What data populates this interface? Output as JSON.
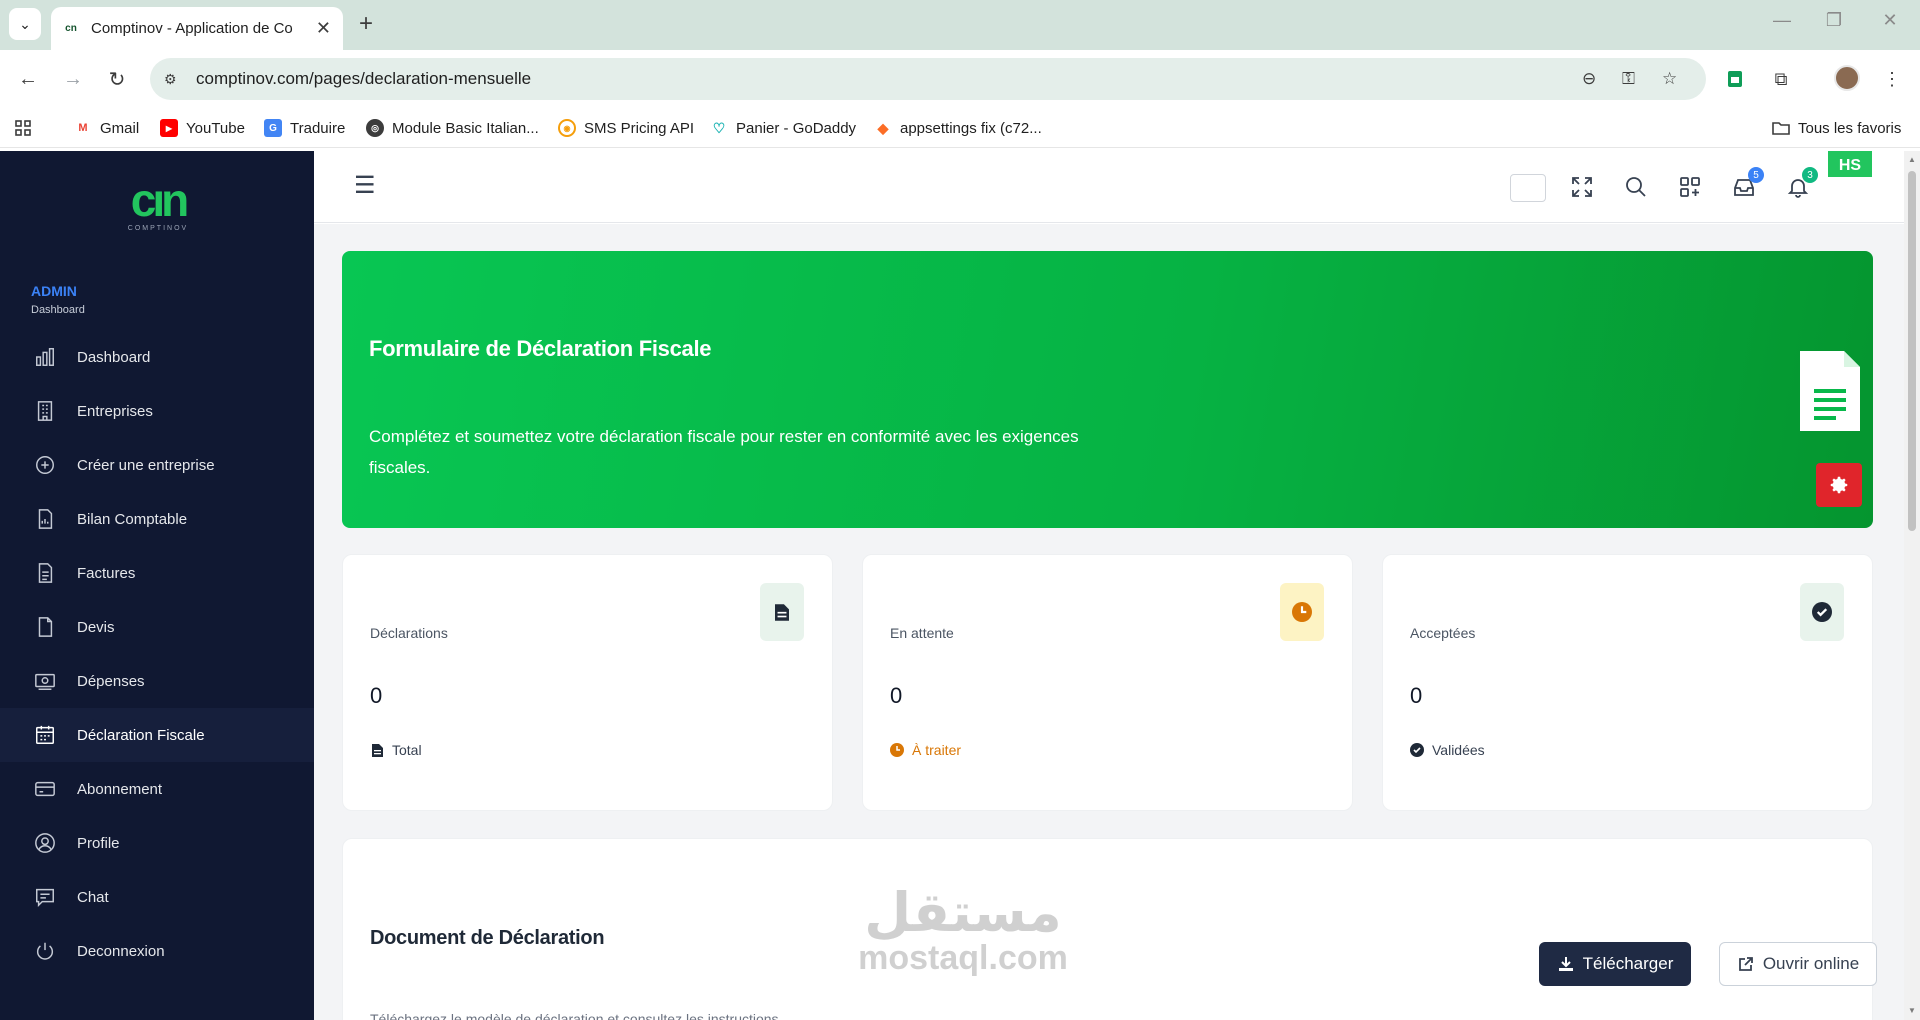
{
  "browser": {
    "tab_title": "Comptinov - Application de Co",
    "tab_favicon": "cn",
    "url": "comptinov.com/pages/declaration-mensuelle",
    "bookmarks": [
      {
        "label": "Gmail",
        "icon": "gmail-icon",
        "color": "#ea4335"
      },
      {
        "label": "YouTube",
        "icon": "youtube-icon",
        "color": "#ff0000"
      },
      {
        "label": "Traduire",
        "icon": "translate-icon",
        "color": "#4285f4"
      },
      {
        "label": "Module Basic Italian...",
        "icon": "globe-icon",
        "color": "#3c3c3c"
      },
      {
        "label": "SMS Pricing API",
        "icon": "sms-icon",
        "color": "#f59e0b"
      },
      {
        "label": "Panier - GoDaddy",
        "icon": "godaddy-icon",
        "color": "#1bdbdb"
      },
      {
        "label": "appsettings fix (c72...",
        "icon": "gitlab-icon",
        "color": "#fc6d26"
      }
    ],
    "all_bookmarks_label": "Tous les favoris"
  },
  "sidebar": {
    "logo_text": "cın",
    "logo_sub": "COMPTINOV",
    "role": "ADMIN",
    "role_sub": "Dashboard",
    "items": [
      {
        "label": "Dashboard",
        "icon": "bar-chart-icon"
      },
      {
        "label": "Entreprises",
        "icon": "building-icon"
      },
      {
        "label": "Créer une entreprise",
        "icon": "plus-circle-icon"
      },
      {
        "label": "Bilan Comptable",
        "icon": "report-icon"
      },
      {
        "label": "Factures",
        "icon": "invoice-icon"
      },
      {
        "label": "Devis",
        "icon": "file-icon"
      },
      {
        "label": "Dépenses",
        "icon": "money-icon"
      },
      {
        "label": "Déclaration Fiscale",
        "icon": "calendar-icon",
        "active": true
      },
      {
        "label": "Abonnement",
        "icon": "credit-card-icon"
      },
      {
        "label": "Profile",
        "icon": "user-icon"
      },
      {
        "label": "Chat",
        "icon": "chat-icon"
      },
      {
        "label": "Deconnexion",
        "icon": "power-icon"
      }
    ]
  },
  "header": {
    "inbox_badge": "5",
    "notif_badge": "3",
    "avatar_initials": "HS",
    "inbox_badge_color": "#3b82f6",
    "notif_badge_color": "#10b981"
  },
  "hero": {
    "title": "Formulaire de Déclaration Fiscale",
    "description": "Complétez et soumettez votre déclaration fiscale pour rester en conformité avec les exigences fiscales."
  },
  "stats": [
    {
      "label": "Déclarations",
      "value": "0",
      "foot": "Total",
      "icon": "document-icon",
      "foot_color": "#374151",
      "icon_bg": "#e8f3ec"
    },
    {
      "label": "En attente",
      "value": "0",
      "foot": "À traiter",
      "icon": "clock-icon",
      "foot_color": "#d97706",
      "icon_bg": "#fdf3c4"
    },
    {
      "label": "Acceptées",
      "value": "0",
      "foot": "Validées",
      "icon": "check-circle-icon",
      "foot_color": "#374151",
      "icon_bg": "#e8f3ec"
    }
  ],
  "document": {
    "title": "Document de Déclaration",
    "hint": "Téléchargez le modèle de déclaration et consultez les instructions",
    "download_label": "Télécharger",
    "open_label": "Ouvrir online"
  },
  "watermark": {
    "arabic": "مستقل",
    "latin": "mostaql.com"
  }
}
